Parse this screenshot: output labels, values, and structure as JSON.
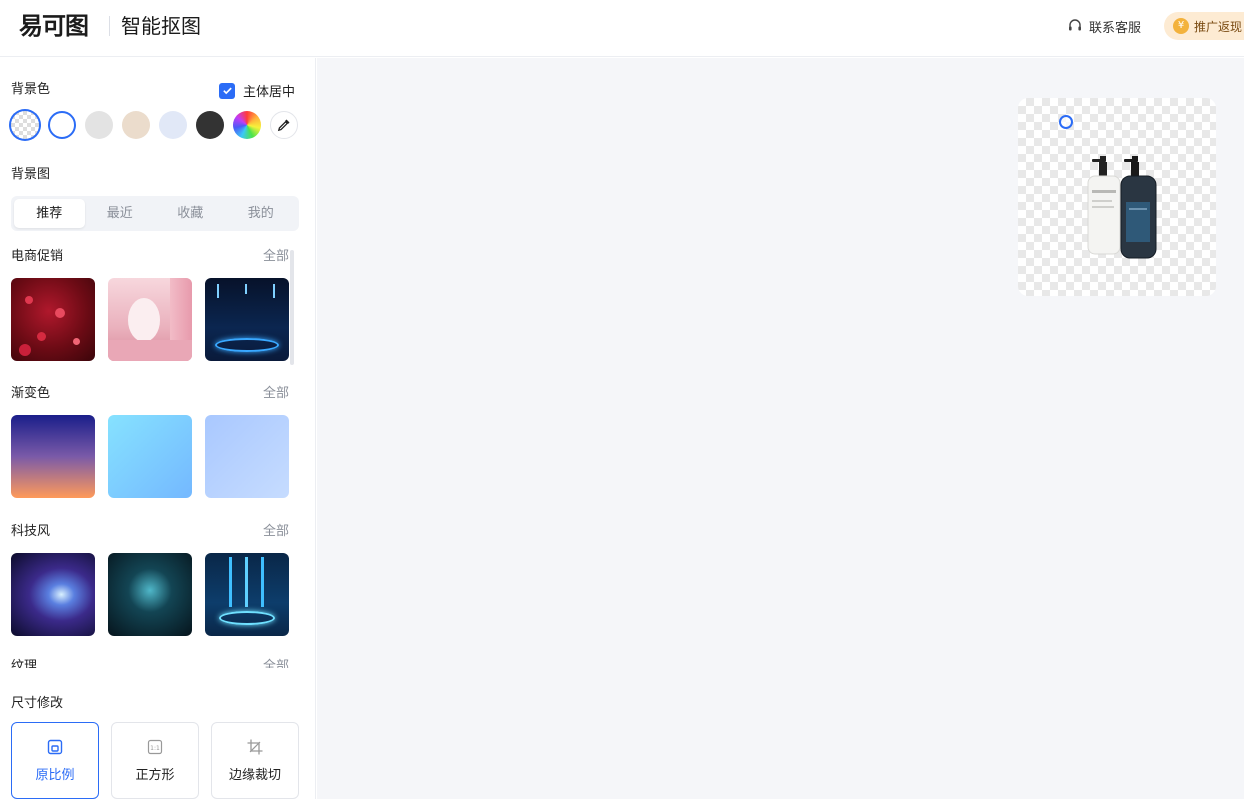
{
  "header": {
    "logo": "易可图",
    "app_title": "智能抠图",
    "support_label": "联系客服",
    "promo_label": "推广返现"
  },
  "sidebar": {
    "bg_color_label": "背景色",
    "center_subject_label": "主体居中",
    "center_subject_checked": true,
    "swatches": [
      {
        "name": "transparent",
        "color": "transparent",
        "selected": true
      },
      {
        "name": "white",
        "color": "#ffffff"
      },
      {
        "name": "light-gray",
        "color": "#e3e3e3"
      },
      {
        "name": "beige",
        "color": "#ebdccc"
      },
      {
        "name": "light-blue",
        "color": "#e1e8f7"
      },
      {
        "name": "dark-gray",
        "color": "#333333"
      },
      {
        "name": "rainbow",
        "color": "conic"
      },
      {
        "name": "eyedropper",
        "icon": "eyedropper-icon"
      }
    ],
    "bg_image_label": "背景图",
    "tabs": [
      "推荐",
      "最近",
      "收藏",
      "我的"
    ],
    "active_tab": "推荐",
    "categories": [
      {
        "title": "电商促销",
        "all": "全部"
      },
      {
        "title": "渐变色",
        "all": "全部"
      },
      {
        "title": "科技风",
        "all": "全部"
      },
      {
        "title": "纹理",
        "all": "全部"
      }
    ],
    "size_label": "尺寸修改",
    "size_options": [
      {
        "label": "原比例",
        "icon": "crop-original-icon",
        "active": true
      },
      {
        "label": "正方形",
        "icon": "square-ratio-icon",
        "badge": "1:1"
      },
      {
        "label": "边缘裁切",
        "icon": "edge-crop-icon"
      }
    ]
  },
  "colors": {
    "accent": "#2b6cf6",
    "canvas_bg": "#f5f6f9"
  }
}
